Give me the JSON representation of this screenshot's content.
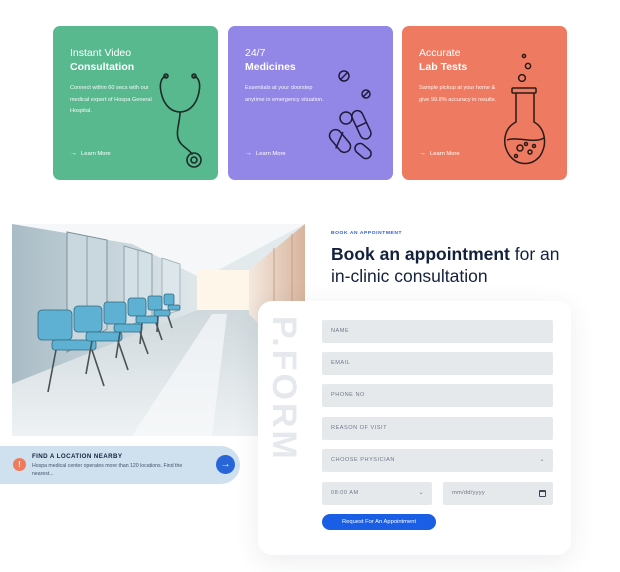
{
  "services": [
    {
      "title_line1": "Instant Video",
      "title_line2": "Consultation",
      "description": "Connect within 60 secs with our medical expert of Hospa General Hospital.",
      "link_label": "Learn More",
      "link_arrow": "→",
      "color": "#58b98f",
      "icon": "stethoscope-icon"
    },
    {
      "title_line1": "24/7",
      "title_line2": "Medicines",
      "description": "Essentials at your doorstep anytime in emergency situation.",
      "link_label": "Learn More",
      "link_arrow": "→",
      "color": "#9286e6",
      "icon": "pills-icon"
    },
    {
      "title_line1": "Accurate",
      "title_line2": "Lab Tests",
      "description": "Sample pickup at your home & give 99.8% accuracy in results.",
      "link_label": "Learn More",
      "link_arrow": "→",
      "color": "#ee7b61",
      "icon": "flask-icon"
    }
  ],
  "location": {
    "icon_glyph": "!",
    "title": "FIND A LOCATION NEARBY",
    "description": "Hospa medical center operates more than 120 locations. Find the nearest...",
    "arrow": "→"
  },
  "appointment": {
    "eyebrow": "BOOK AN APPOINTMENT",
    "heading_bold": "Book an appointment",
    "heading_rest": " for an in-clinic consultation",
    "watermark": "P.FORM",
    "fields": {
      "name": "NAME",
      "email": "EMAIL",
      "phone": "PHONE NO",
      "reason": "REASON OF VISIT",
      "physician": "CHOOSE PHYSICIAN",
      "time": "08:00 AM",
      "date": "mm/dd/yyyy"
    },
    "caret": "⌄",
    "submit_label": "Request For An Appointment"
  },
  "colors": {
    "accent": "#1a5ee6",
    "heading": "#14213d",
    "field_bg": "#e6e9ec"
  }
}
